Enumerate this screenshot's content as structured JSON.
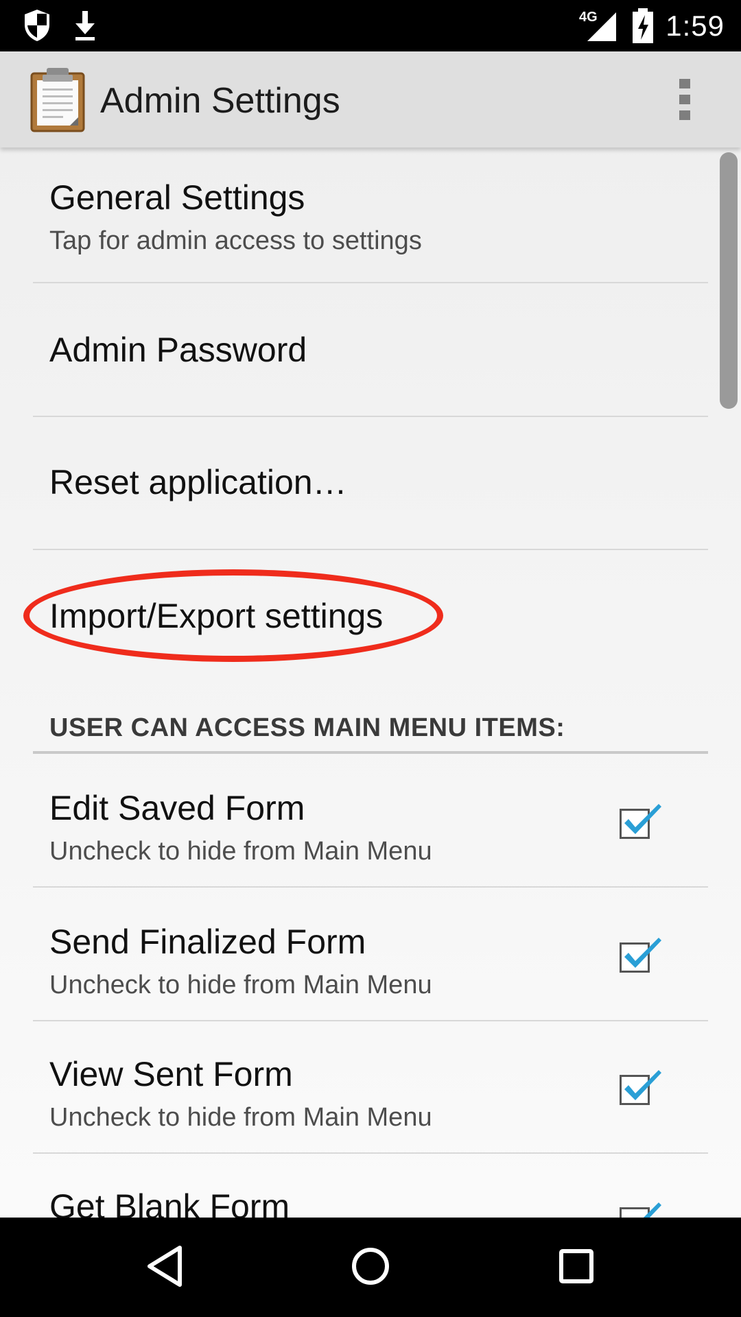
{
  "status_bar": {
    "time": "1:59",
    "network": "4G",
    "icons": [
      "shield-icon",
      "download-icon",
      "signal-icon",
      "battery-charging-icon"
    ]
  },
  "app_bar": {
    "title": "Admin Settings",
    "icon": "clipboard-icon",
    "menu_icon": "overflow-menu-icon"
  },
  "preferences": [
    {
      "title": "General Settings",
      "summary": "Tap for admin access to settings"
    },
    {
      "title": "Admin Password"
    },
    {
      "title": "Reset application…"
    },
    {
      "title": "Import/Export settings"
    }
  ],
  "category": {
    "label": "USER CAN ACCESS MAIN MENU ITEMS:"
  },
  "menu_items": [
    {
      "title": "Edit Saved Form",
      "summary": "Uncheck to hide from Main Menu",
      "checked": true
    },
    {
      "title": "Send Finalized Form",
      "summary": "Uncheck to hide from Main Menu",
      "checked": true
    },
    {
      "title": "View Sent Form",
      "summary": "Uncheck to hide from Main Menu",
      "checked": true
    },
    {
      "title": "Get Blank Form",
      "checked": true
    }
  ],
  "nav_bar": {
    "icons": [
      "back-icon",
      "home-icon",
      "recents-icon"
    ]
  },
  "colors": {
    "highlight": "#ef2c1c",
    "checkmark": "#2a9fd6",
    "app_bar": "#dfdfdf"
  }
}
